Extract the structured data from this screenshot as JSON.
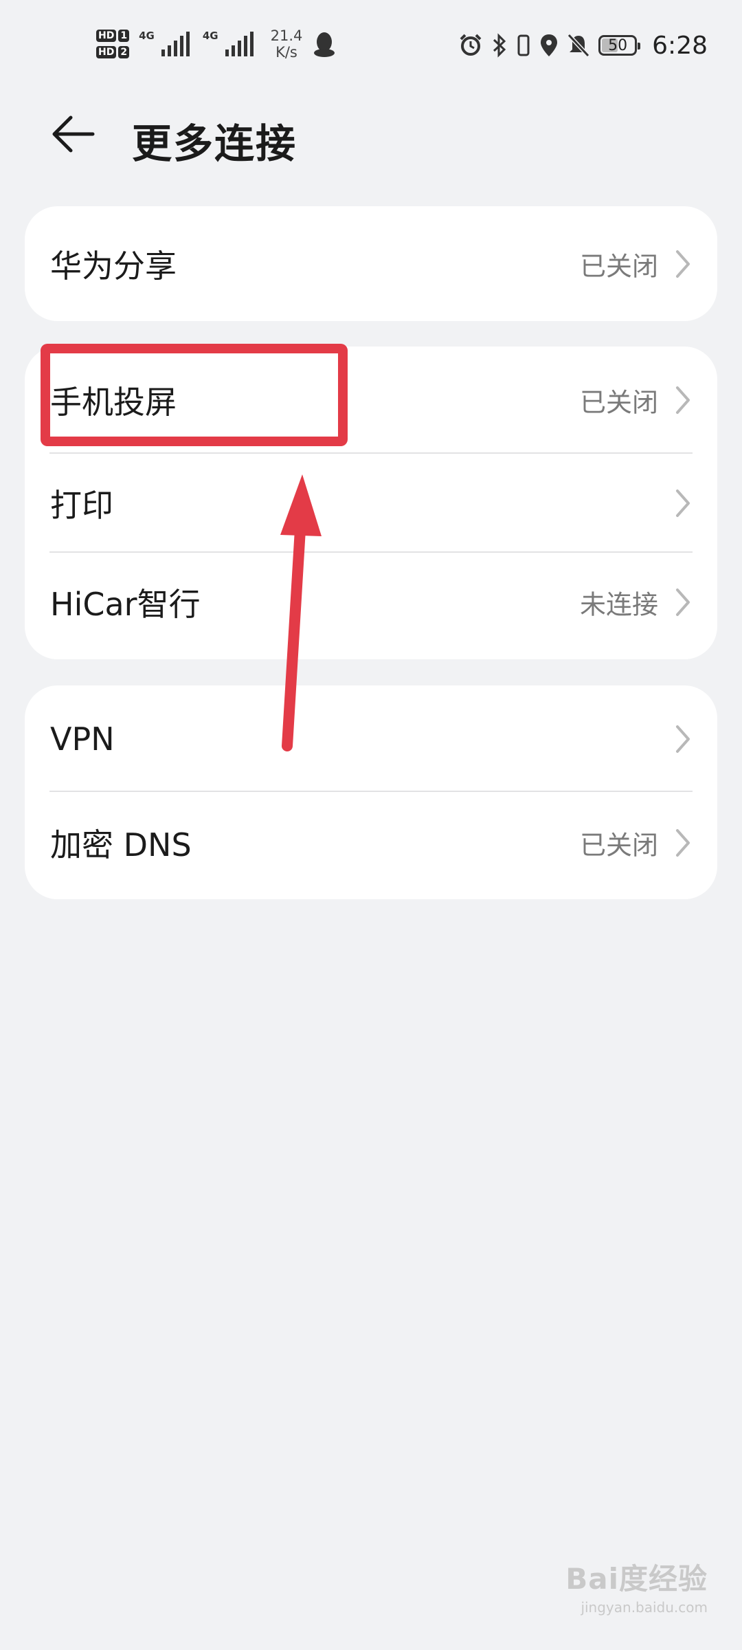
{
  "status_bar": {
    "sim1": "HD",
    "sim1_slot": "1",
    "sim2": "HD",
    "sim2_slot": "2",
    "net1": "4G",
    "net2": "4G",
    "speed_value": "21.4",
    "speed_unit": "K/s",
    "battery_level": "50",
    "time": "6:28",
    "icons": [
      "qq-icon",
      "alarm-icon",
      "bluetooth-icon",
      "vibrate-icon",
      "location-icon",
      "mute-bell-icon",
      "battery-icon"
    ]
  },
  "header": {
    "title": "更多连接",
    "back_icon": "back-arrow-icon"
  },
  "groups": [
    {
      "items": [
        {
          "label": "华为分享",
          "status": "已关闭"
        }
      ]
    },
    {
      "items": [
        {
          "label": "手机投屏",
          "status": "已关闭"
        },
        {
          "label": "打印",
          "status": ""
        },
        {
          "label": "HiCar智行",
          "status": "未连接"
        }
      ]
    },
    {
      "items": [
        {
          "label": "VPN",
          "status": ""
        },
        {
          "label": "加密 DNS",
          "status": "已关闭"
        }
      ]
    }
  ],
  "annotation": {
    "color": "#e33b47"
  },
  "watermark": {
    "brand": "Bai度经验",
    "url": "jingyan.baidu.com"
  },
  "colors": {
    "background": "#f1f2f4",
    "card": "#ffffff",
    "secondary_text": "#7a7a7a"
  }
}
